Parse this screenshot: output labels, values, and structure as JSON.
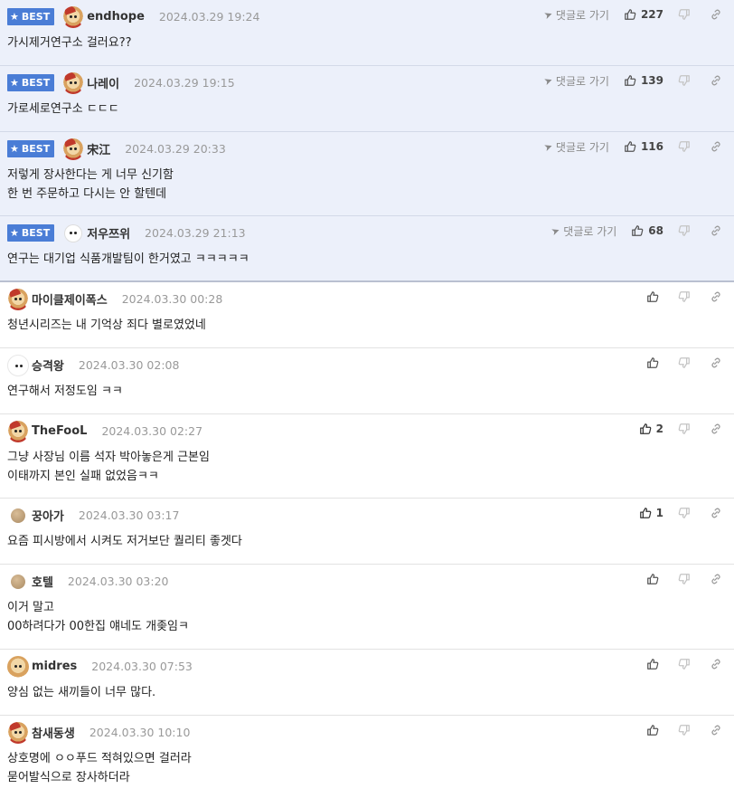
{
  "labels": {
    "best": "BEST",
    "goto": "댓글로 가기"
  },
  "comments": [
    {
      "best": true,
      "avatar": "dog-red",
      "nick": "endhope",
      "date": "2024.03.29 19:24",
      "likes": "227",
      "lines": [
        "가시제거연구소 걸러요??"
      ]
    },
    {
      "best": true,
      "avatar": "dog-red",
      "nick": "나레이",
      "date": "2024.03.29 19:15",
      "likes": "139",
      "lines": [
        "가로세로연구소 ㄷㄷㄷ"
      ]
    },
    {
      "best": true,
      "avatar": "dog-red",
      "nick": "宋江",
      "date": "2024.03.29 20:33",
      "likes": "116",
      "lines": [
        "저렇게 장사한다는 게 너무 신기함",
        "한 번 주문하고 다시는 안 할텐데"
      ]
    },
    {
      "best": true,
      "avatar": "white",
      "nick": "저우쯔위",
      "date": "2024.03.29 21:13",
      "likes": "68",
      "lines": [
        "연구는 대기업 식품개발팀이 한거였고 ㅋㅋㅋㅋㅋ"
      ]
    },
    {
      "best": false,
      "avatar": "dog-red",
      "nick": "마이클제이폭스",
      "date": "2024.03.30 00:28",
      "likes": "",
      "lines": [
        "청년시리즈는 내 기억상 죄다 별로였었네"
      ]
    },
    {
      "best": false,
      "avatar": "bear",
      "nick": "승격왕",
      "date": "2024.03.30 02:08",
      "likes": "",
      "lines": [
        "연구해서 저정도임 ㅋㅋ"
      ]
    },
    {
      "best": false,
      "avatar": "dog-red",
      "nick": "TheFooL",
      "date": "2024.03.30 02:27",
      "likes": "2",
      "lines": [
        "그냥 사장님 이름 석자 박아놓은게 근본임",
        "이태까지 본인 실패 없었음ㅋㅋ"
      ]
    },
    {
      "best": false,
      "avatar": "ball",
      "nick": "꿍아가",
      "date": "2024.03.30 03:17",
      "likes": "1",
      "lines": [
        "요즘 피시방에서 시켜도 저거보단 퀄리티 좋겟다"
      ]
    },
    {
      "best": false,
      "avatar": "ball",
      "nick": "호텔",
      "date": "2024.03.30 03:20",
      "likes": "",
      "lines": [
        "이거 말고",
        "00하려다가 00한집 얘네도 개좆임ㅋ"
      ]
    },
    {
      "best": false,
      "avatar": "dog",
      "nick": "midres",
      "date": "2024.03.30 07:53",
      "likes": "",
      "lines": [
        "양심 없는 새끼들이 너무 많다."
      ]
    },
    {
      "best": false,
      "avatar": "dog-red",
      "nick": "참새동생",
      "date": "2024.03.30 10:10",
      "likes": "",
      "lines": [
        "상호명에 ㅇㅇ푸드 적혀있으면 걸러라",
        "묻어발식으로 장사하더라"
      ]
    }
  ]
}
